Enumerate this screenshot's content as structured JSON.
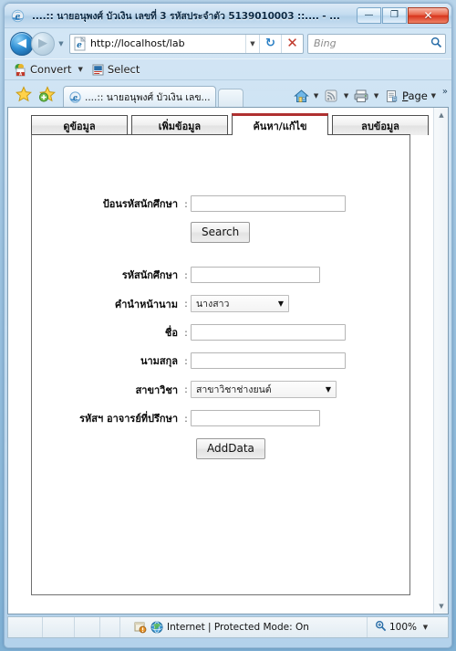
{
  "window": {
    "title": "....:: นายอนุพงศ์ บัวเงิน เลขที่ 3 รหัสประจำตัว 5139010003 ::.... - ...",
    "minimize_label": "—",
    "maximize_label": "❐",
    "close_label": "✕"
  },
  "nav": {
    "back_label": "◀",
    "forward_label": "▶",
    "history_caret": "▼",
    "address_value": "http://localhost/lab",
    "address_caret": "▼",
    "refresh_label": "↻",
    "stop_label": "✕",
    "search_placeholder": "Bing",
    "search_icon": "search-icon"
  },
  "adobe_toolbar": {
    "convert_label": "Convert",
    "convert_caret": "▼",
    "select_label": "Select"
  },
  "tabbar": {
    "favorites_icon": "star-icon",
    "add_favorite_icon": "star-plus-icon",
    "browser_tab_title": "....:: นายอนุพงศ์ บัวเงิน เลข...",
    "new_tab_label": "",
    "home_icon": "home-icon",
    "feeds_icon": "rss-icon",
    "print_icon": "printer-icon",
    "page_label": "Page",
    "page_underline": "P",
    "page_rest": "age",
    "caret": "▼",
    "overflow_label": "»"
  },
  "page": {
    "tabs": [
      {
        "label": "ดูข้อมูล",
        "active": false
      },
      {
        "label": "เพิ่มข้อมูล",
        "active": false
      },
      {
        "label": "ค้นหา/แก้ไข",
        "active": true
      },
      {
        "label": "ลบข้อมูล",
        "active": false
      }
    ],
    "search_section": {
      "label": "ป้อนรหัสนักศึกษา",
      "colon": ":",
      "input_value": "",
      "button_label": "Search"
    },
    "fields": [
      {
        "label": "รหัสนักศึกษา",
        "colon": ":",
        "type": "text",
        "value": ""
      },
      {
        "label": "คำนำหน้านาม",
        "colon": ":",
        "type": "select",
        "value": "นางสาว",
        "caret": "▼"
      },
      {
        "label": "ชื่อ",
        "colon": ":",
        "type": "text",
        "value": ""
      },
      {
        "label": "นามสกุล",
        "colon": ":",
        "type": "text",
        "value": ""
      },
      {
        "label": "สาขาวิชา",
        "colon": ":",
        "type": "select",
        "value": "สาขาวิชาช่างยนต์",
        "caret": "▼"
      },
      {
        "label": "รหัสฯ อาจารย์ที่ปรึกษา",
        "colon": ":",
        "type": "text",
        "value": ""
      }
    ],
    "submit_button_label": "AddData"
  },
  "scrollbar": {
    "up_label": "▲",
    "down_label": "▼"
  },
  "statusbar": {
    "zone_text": "Internet | Protected Mode: On",
    "zone_icon": "globe-icon",
    "protected_icon": "shield-icon",
    "zoom_icon": "zoom-icon",
    "zoom_level": "100%",
    "zoom_caret": "▼"
  },
  "colors": {
    "active_tab_accent": "#b03030",
    "titlebar_text": "#0d2a44",
    "close_button": "#d8341c"
  }
}
